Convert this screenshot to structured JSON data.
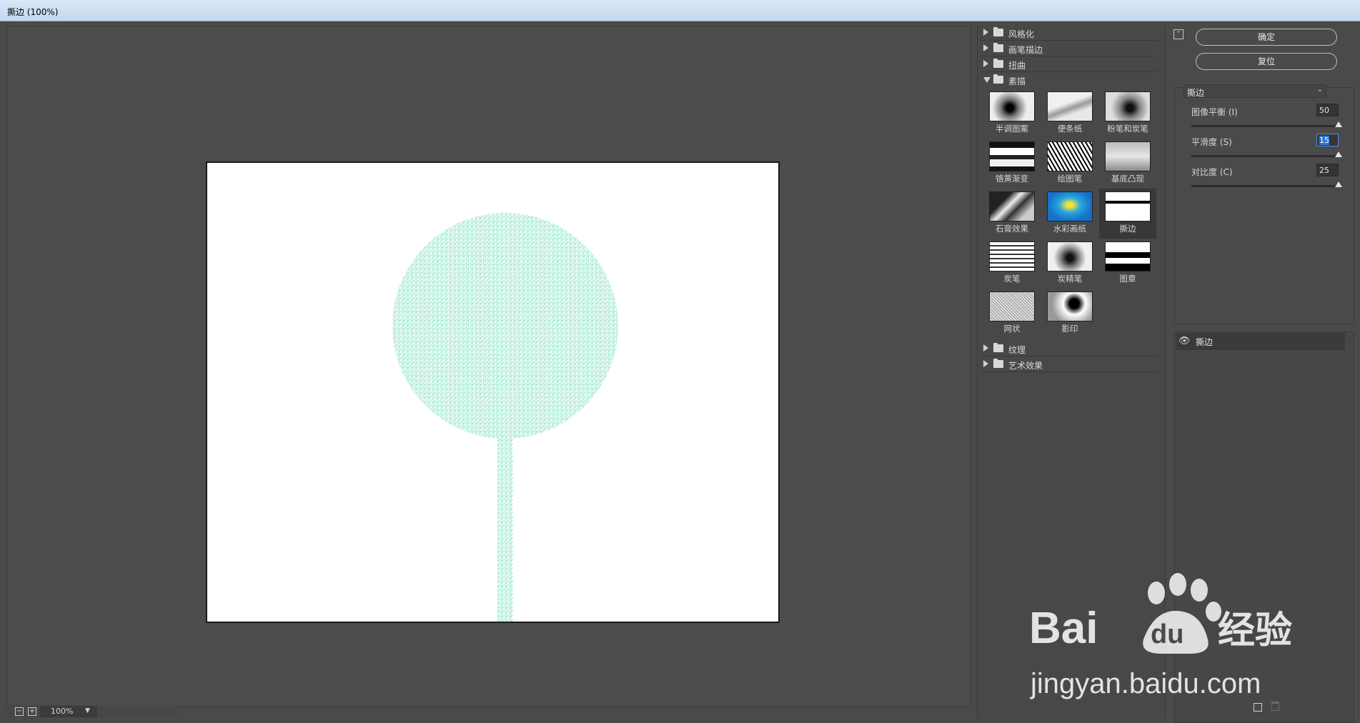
{
  "window": {
    "title": "撕边 (100%)"
  },
  "preview": {
    "zoom": "100%",
    "zoom_out_symbol": "−",
    "zoom_in_symbol": "+",
    "canvas_shape_color": "#a8ecd8"
  },
  "gallery": {
    "folders_top": [
      {
        "label": "风格化",
        "state": "closed"
      },
      {
        "label": "画笔描边",
        "state": "closed"
      },
      {
        "label": "扭曲",
        "state": "closed"
      },
      {
        "label": "素描",
        "state": "open"
      }
    ],
    "thumbnails": [
      {
        "label": "半调图案"
      },
      {
        "label": "便条纸"
      },
      {
        "label": "粉笔和炭笔"
      },
      {
        "label": "铬黄渐变"
      },
      {
        "label": "绘图笔"
      },
      {
        "label": "基底凸现"
      },
      {
        "label": "石膏效果"
      },
      {
        "label": "水彩画纸"
      },
      {
        "label": "撕边",
        "selected": true
      },
      {
        "label": "炭笔"
      },
      {
        "label": "炭精笔"
      },
      {
        "label": "图章"
      },
      {
        "label": "网状"
      },
      {
        "label": "影印"
      }
    ],
    "folders_bottom": [
      {
        "label": "纹理",
        "state": "closed"
      },
      {
        "label": "艺术效果",
        "state": "closed"
      }
    ]
  },
  "panel": {
    "ok_label": "确定",
    "reset_label": "复位",
    "filter_select": "撕边",
    "params": [
      {
        "label": "图像平衡 (I)",
        "value": "50",
        "max": 50
      },
      {
        "label": "平滑度 (S)",
        "value": "15",
        "max": 15,
        "focused": true
      },
      {
        "label": "对比度 (C)",
        "value": "25",
        "max": 25
      }
    ],
    "layer_name": "撕边"
  },
  "watermark": {
    "brand": "Baidu经验",
    "url": "jingyan.baidu.com"
  }
}
